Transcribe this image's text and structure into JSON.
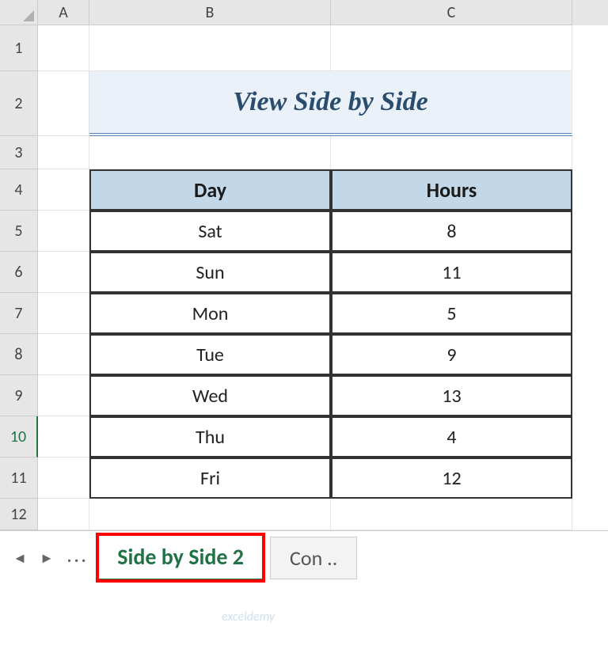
{
  "columns": {
    "a": "A",
    "b": "B",
    "c": "C"
  },
  "rows": {
    "r1": "1",
    "r2": "2",
    "r3": "3",
    "r4": "4",
    "r5": "5",
    "r6": "6",
    "r7": "7",
    "r8": "8",
    "r9": "9",
    "r10": "10",
    "r11": "11",
    "r12": "12"
  },
  "title": "View Side by Side",
  "table": {
    "headers": {
      "day": "Day",
      "hours": "Hours"
    },
    "rows": [
      {
        "day": "Sat",
        "hours": "8"
      },
      {
        "day": "Sun",
        "hours": "11"
      },
      {
        "day": "Mon",
        "hours": "5"
      },
      {
        "day": "Tue",
        "hours": "9"
      },
      {
        "day": "Wed",
        "hours": "13"
      },
      {
        "day": "Thu",
        "hours": "4"
      },
      {
        "day": "Fri",
        "hours": "12"
      }
    ]
  },
  "nav": {
    "prev": "◄",
    "next": "►",
    "ellipsis": "..."
  },
  "tabs": {
    "active": "Side by Side 2",
    "next": "Con .."
  },
  "watermark": "exceldemy",
  "chart_data": {
    "type": "table",
    "title": "View Side by Side",
    "columns": [
      "Day",
      "Hours"
    ],
    "rows": [
      [
        "Sat",
        8
      ],
      [
        "Sun",
        11
      ],
      [
        "Mon",
        5
      ],
      [
        "Tue",
        9
      ],
      [
        "Wed",
        13
      ],
      [
        "Thu",
        4
      ],
      [
        "Fri",
        12
      ]
    ]
  }
}
